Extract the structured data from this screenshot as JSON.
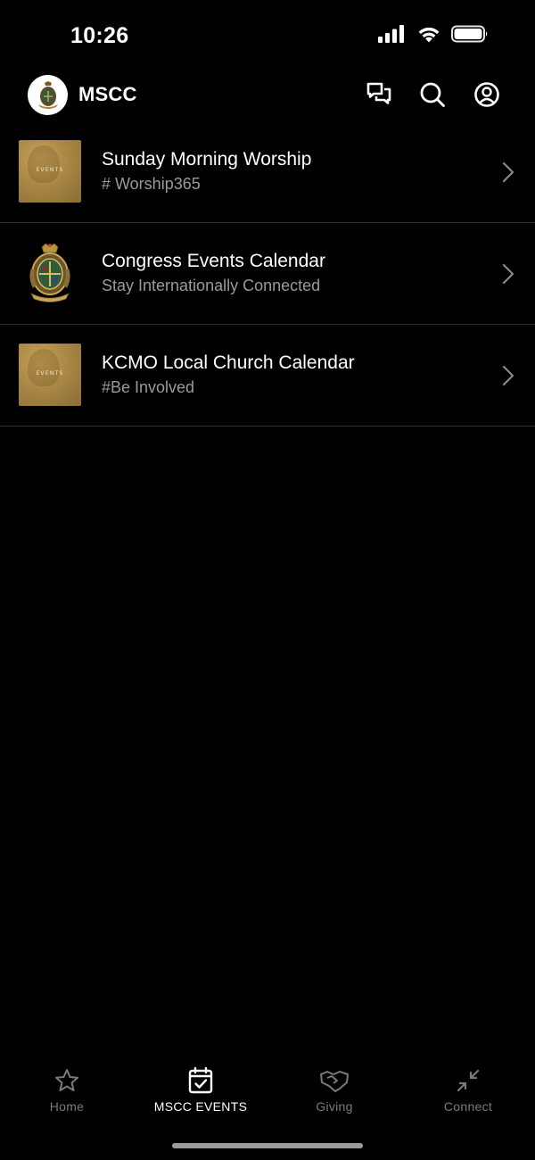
{
  "status_bar": {
    "time": "10:26"
  },
  "header": {
    "app_title": "MSCC"
  },
  "events": [
    {
      "title": "Sunday Morning Worship",
      "subtitle": "# Worship365",
      "thumb_type": "events",
      "thumb_label": "EVENTS"
    },
    {
      "title": "Congress Events Calendar",
      "subtitle": "Stay Internationally Connected",
      "thumb_type": "crest"
    },
    {
      "title": "KCMO Local Church Calendar",
      "subtitle": "#Be Involved",
      "thumb_type": "events",
      "thumb_label": "EVENTS"
    }
  ],
  "tabs": [
    {
      "label": "Home",
      "icon": "star-icon",
      "active": false
    },
    {
      "label": "MSCC EVENTS",
      "icon": "calendar-check-icon",
      "active": true
    },
    {
      "label": "Giving",
      "icon": "handshake-icon",
      "active": false
    },
    {
      "label": "Connect",
      "icon": "collapse-arrows-icon",
      "active": false
    }
  ],
  "colors": {
    "background": "#000000",
    "text_primary": "#ffffff",
    "text_secondary": "#9a9a9a",
    "divider": "#2e2e2e",
    "thumb_gold": "#a98845",
    "tab_inactive": "#7a7a7a"
  }
}
